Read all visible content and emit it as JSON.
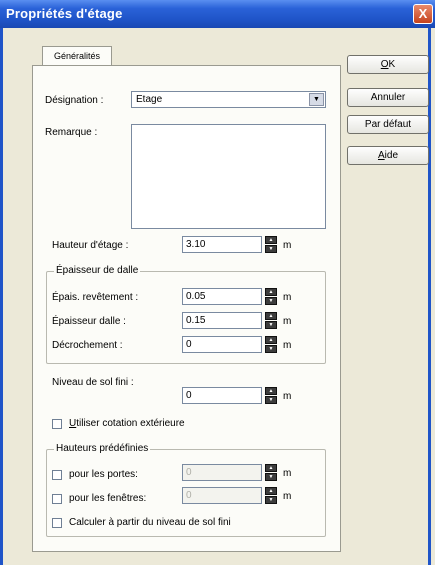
{
  "window": {
    "title": "Propriétés d'étage",
    "close": "X"
  },
  "tabs": [
    {
      "label": "Généralités"
    }
  ],
  "fields": {
    "designation": {
      "label": "Désignation :",
      "value": "Etage"
    },
    "remarque": {
      "label": "Remarque :",
      "value": ""
    },
    "hauteur_etage": {
      "label": "Hauteur d'étage :",
      "value": "3.10",
      "unit": "m"
    },
    "niveau_sol": {
      "label": "Niveau de sol fini :",
      "value": "0",
      "unit": "m"
    }
  },
  "epaisseur_group": {
    "title": "Épaisseur de dalle",
    "rows": [
      {
        "label": "Épais. revêtement :",
        "value": "0.05",
        "unit": "m"
      },
      {
        "label": "Épaisseur dalle :",
        "value": "0.15",
        "unit": "m"
      },
      {
        "label": "Décrochement :",
        "value": "0",
        "unit": "m"
      }
    ]
  },
  "cotation": {
    "label_prefix": "U",
    "label_rest": "tiliser cotation extérieure",
    "checked": false
  },
  "hauteurs_group": {
    "title": "Hauteurs prédéfinies",
    "portes": {
      "label": "pour les portes:",
      "value": "0",
      "unit": "m"
    },
    "fenetres": {
      "label": "pour les fenêtres:",
      "value": "0",
      "unit": "m"
    },
    "calculer": {
      "label": "Calculer à partir du niveau de sol fini"
    }
  },
  "buttons": {
    "ok": {
      "u": "O",
      "rest": "K"
    },
    "annuler": "Annuler",
    "defaut": "Par défaut",
    "aide": {
      "u": "A",
      "rest": "ide"
    }
  }
}
